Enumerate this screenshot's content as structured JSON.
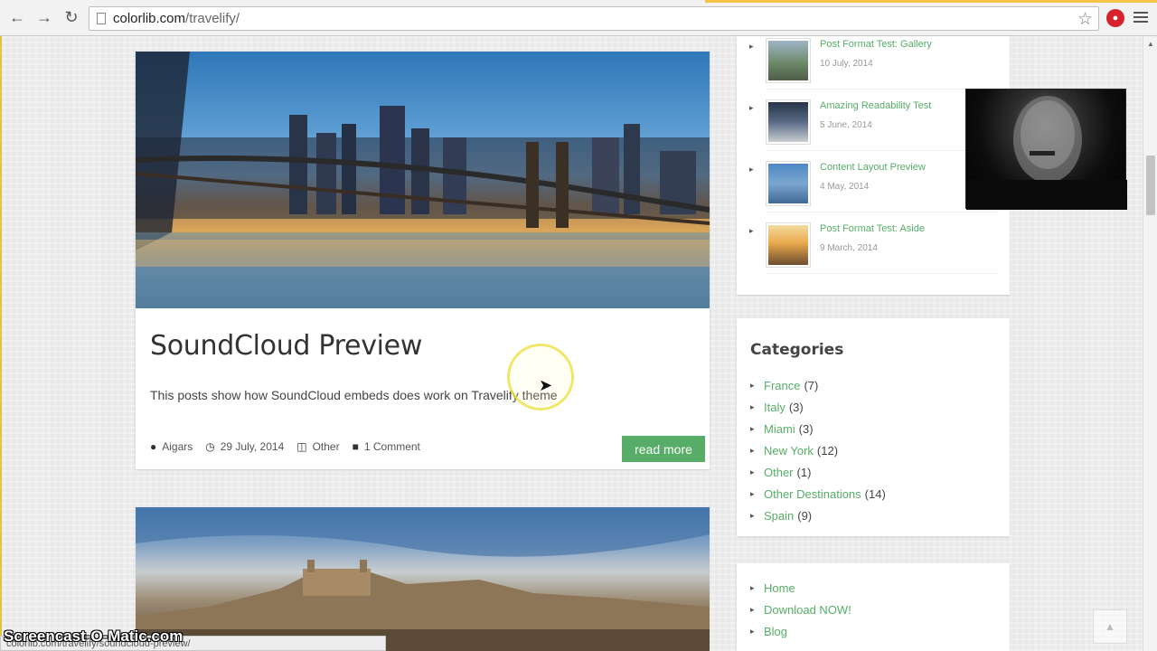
{
  "browser": {
    "url_domain": "colorlib.com",
    "url_path": "/travelify/",
    "back_icon": "arrow-left-icon",
    "forward_icon": "arrow-right-icon",
    "reload_icon": "reload-icon"
  },
  "post": {
    "title": "SoundCloud Preview",
    "excerpt": "This posts show how SoundCloud embeds does work on Travelify theme",
    "author": "Aigars",
    "date": "29 July, 2014",
    "category": "Other",
    "comments": "1 Comment",
    "read_more": "read more"
  },
  "sidebar": {
    "recent_posts": [
      {
        "title": "Post Format Test: Gallery",
        "date": "10 July, 2014"
      },
      {
        "title": "Amazing Readability Test",
        "date": "5 June, 2014"
      },
      {
        "title": "Content Layout Preview",
        "date": "4 May, 2014"
      },
      {
        "title": "Post Format Test: Aside",
        "date": "9 March, 2014"
      }
    ],
    "categories_title": "Categories",
    "categories": [
      {
        "name": "France",
        "count": "(7)"
      },
      {
        "name": "Italy",
        "count": "(3)"
      },
      {
        "name": "Miami",
        "count": "(3)"
      },
      {
        "name": "New York",
        "count": "(12)"
      },
      {
        "name": "Other",
        "count": "(1)"
      },
      {
        "name": "Other Destinations",
        "count": "(14)"
      },
      {
        "name": "Spain",
        "count": "(9)"
      }
    ],
    "menu": [
      {
        "label": "Home"
      },
      {
        "label": "Download NOW!"
      },
      {
        "label": "Blog"
      }
    ]
  },
  "status_bar_url": "colorlib.com/travelify/soundcloud-preview/",
  "watermark": "Screencast-O-Matic.com",
  "colors": {
    "accent": "#57ad68"
  }
}
